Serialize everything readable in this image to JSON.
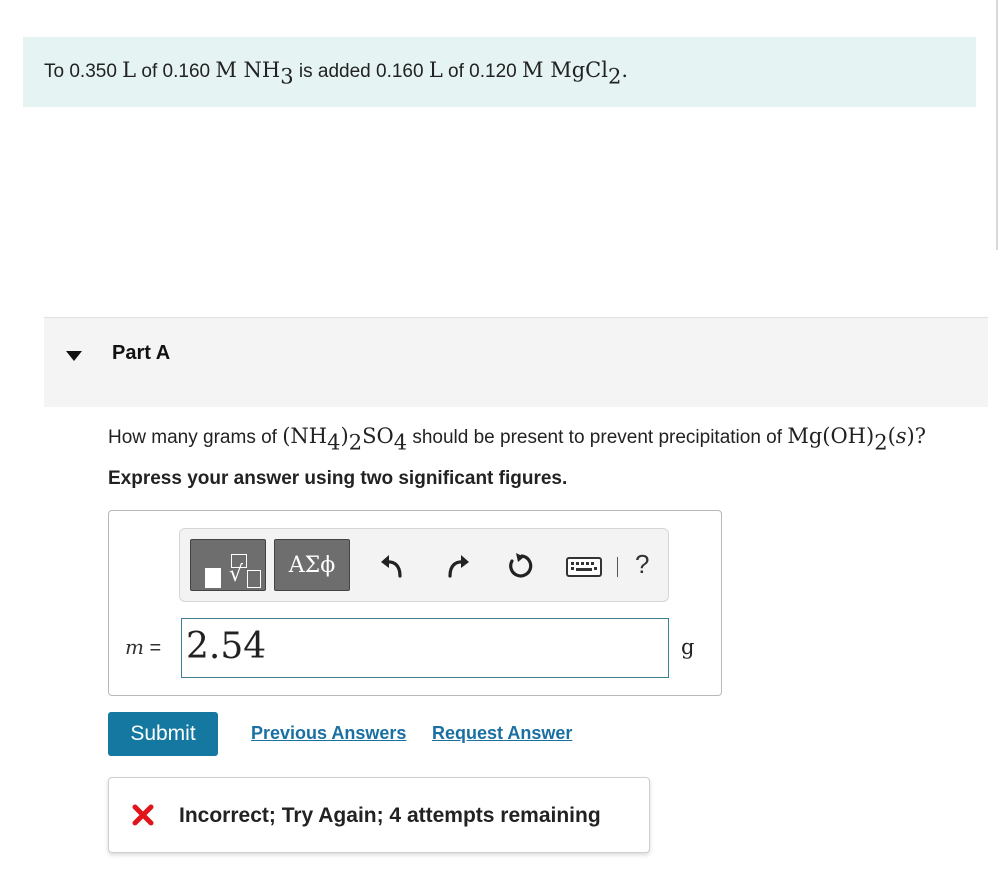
{
  "intro": {
    "t1": "To 0.350 ",
    "u1": "L",
    "t2": " of 0.160 ",
    "c1": "M NH",
    "c1_sub": "3",
    "t3": " is added 0.160 ",
    "u2": "L",
    "t4": " of 0.120 ",
    "c2": "M MgCl",
    "c2_sub": "2",
    "end": "."
  },
  "part": {
    "title": "Part A"
  },
  "question": {
    "t1": "How many grams of ",
    "f1a": "(NH",
    "f1a_sub": "4",
    "f1b": ")",
    "f1b_sub": "2",
    "f1c": "SO",
    "f1c_sub": "4",
    "t2": " should be present to prevent precipitation of ",
    "f2a": "Mg(OH)",
    "f2a_sub": "2",
    "f2b": "(",
    "f2_state": "s",
    "f2c": ")",
    "end": "?"
  },
  "instruction": "Express your answer using two significant figures.",
  "toolbar": {
    "greek_label": "ΑΣϕ",
    "help_label": "?",
    "icons": [
      "templates-icon",
      "undo-icon",
      "redo-icon",
      "reset-icon",
      "keyboard-icon",
      "help-icon"
    ]
  },
  "answer": {
    "var": "m",
    "equals": " =",
    "value": "2.54",
    "unit": "g"
  },
  "actions": {
    "submit": "Submit",
    "previous": "Previous Answers",
    "request": "Request Answer"
  },
  "feedback": {
    "text": "Incorrect; Try Again; 4 attempts remaining",
    "color": "#e1141c"
  }
}
